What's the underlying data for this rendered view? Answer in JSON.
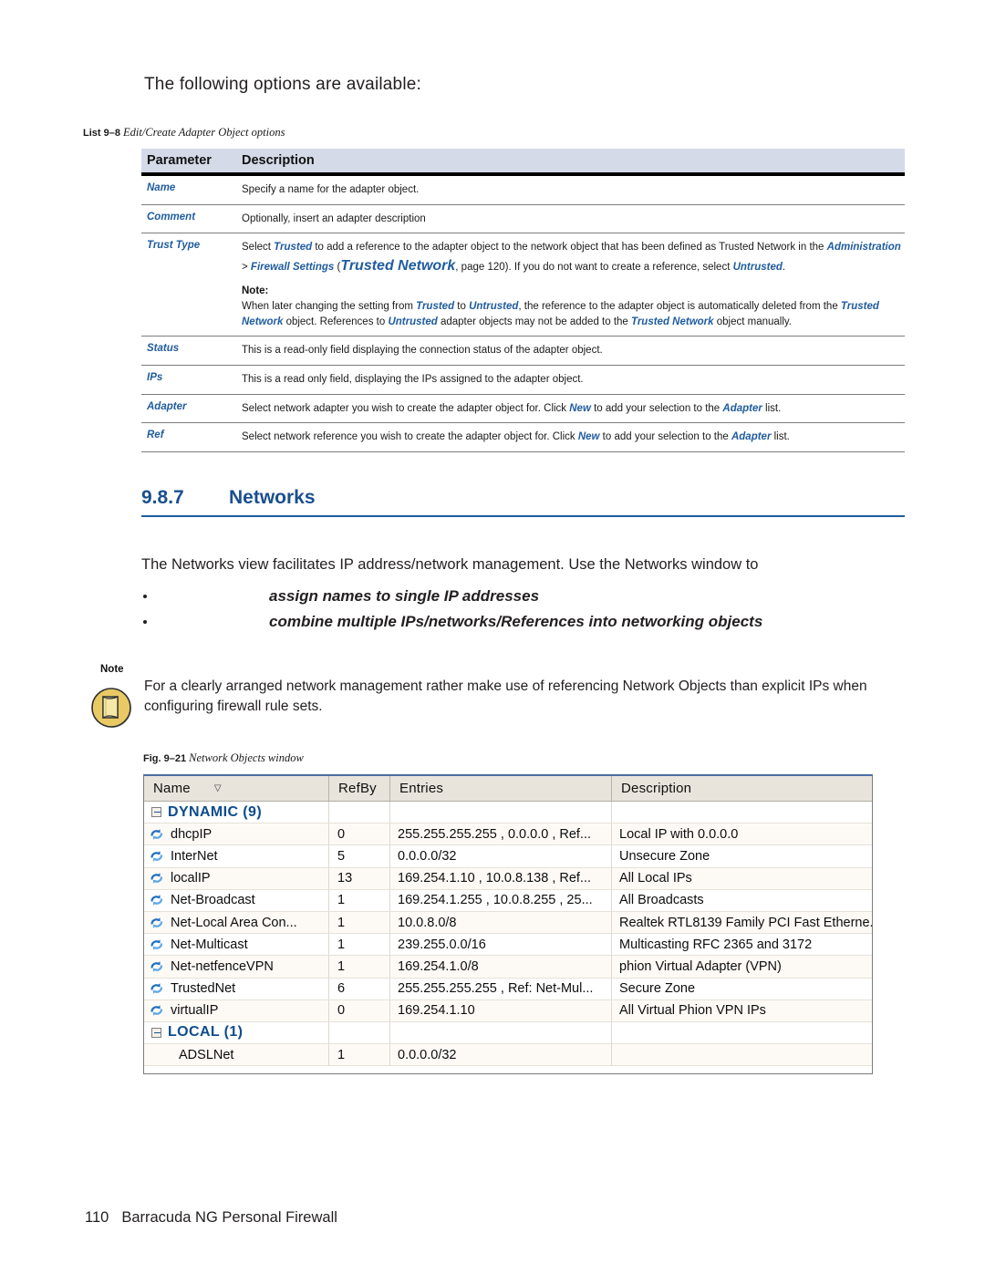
{
  "intro": "The following options are available:",
  "list_caption": {
    "lead": "List 9–8",
    "italic": "Edit/Create Adapter Object options"
  },
  "param_table": {
    "headers": {
      "parameter": "Parameter",
      "description": "Description"
    },
    "rows": [
      {
        "param": "Name",
        "desc": "Specify a name for the adapter object."
      },
      {
        "param": "Comment",
        "desc": "Optionally, insert an adapter description"
      },
      {
        "param": "Trust Type",
        "desc_segments": [
          {
            "t": "Select ",
            "s": "plain"
          },
          {
            "t": "Trusted",
            "s": "blue"
          },
          {
            "t": " to add a reference to the adapter object to the network object that has been defined as Trusted Network in the ",
            "s": "plain"
          },
          {
            "t": "Administration",
            "s": "blue"
          },
          {
            "t": " > ",
            "s": "plain"
          },
          {
            "t": "Firewall Settings",
            "s": "blue"
          },
          {
            "t": " (",
            "s": "plain"
          },
          {
            "t": "Trusted Network",
            "s": "blue-big"
          },
          {
            "t": ", page 120). If you do not want to create a reference, select ",
            "s": "plain"
          },
          {
            "t": "Untrusted",
            "s": "blue"
          },
          {
            "t": ".",
            "s": "plain"
          }
        ],
        "note_label": "Note:",
        "note_segments": [
          {
            "t": "When later changing the setting from ",
            "s": "plain"
          },
          {
            "t": "Trusted",
            "s": "blue"
          },
          {
            "t": " to ",
            "s": "plain"
          },
          {
            "t": "Untrusted",
            "s": "blue"
          },
          {
            "t": ", the reference to the adapter object is automatically deleted from the ",
            "s": "plain"
          },
          {
            "t": "Trusted Network",
            "s": "blue"
          },
          {
            "t": " object. References to ",
            "s": "plain"
          },
          {
            "t": "Untrusted",
            "s": "blue"
          },
          {
            "t": " adapter objects may not be added to the ",
            "s": "plain"
          },
          {
            "t": "Trusted Network",
            "s": "blue"
          },
          {
            "t": " object manually.",
            "s": "plain"
          }
        ]
      },
      {
        "param": "Status",
        "desc": "This is a read-only field displaying the connection status of the adapter object."
      },
      {
        "param": "IPs",
        "desc": "This is a read only field, displaying the IPs assigned to the adapter object."
      },
      {
        "param": "Adapter",
        "desc_segments": [
          {
            "t": "Select network adapter you wish to create the adapter object for. Click ",
            "s": "plain"
          },
          {
            "t": "New",
            "s": "blue"
          },
          {
            "t": " to add your selection to the ",
            "s": "plain"
          },
          {
            "t": "Adapter",
            "s": "blue"
          },
          {
            "t": " list.",
            "s": "plain"
          }
        ]
      },
      {
        "param": "Ref",
        "desc_segments": [
          {
            "t": "Select network reference you wish to create the adapter object for. Click ",
            "s": "plain"
          },
          {
            "t": "New",
            "s": "blue"
          },
          {
            "t": " to add your selection to the ",
            "s": "plain"
          },
          {
            "t": "Adapter",
            "s": "blue"
          },
          {
            "t": " list.",
            "s": "plain"
          }
        ]
      }
    ]
  },
  "section": {
    "number": "9.8.7",
    "title": "Networks"
  },
  "body_paragraph": "The Networks view facilitates IP address/network management. Use the Networks window to",
  "bullets": [
    "assign names to single IP addresses",
    "combine multiple IPs/networks/References into networking objects"
  ],
  "note": {
    "label": "Note",
    "icon": "note-document-icon",
    "text": "For a clearly arranged network management rather make use of referencing Network Objects than explicit IPs when configuring firewall rule sets."
  },
  "figure_caption": {
    "lead": "Fig. 9–21",
    "italic": "Network Objects window"
  },
  "network_objects_window": {
    "columns": [
      "Name",
      "RefBy",
      "Entries",
      "Description"
    ],
    "sort_indicator": "▽",
    "rows": [
      {
        "type": "group",
        "name": "DYNAMIC (9)",
        "refby": "",
        "entries": "",
        "description": ""
      },
      {
        "type": "item",
        "icon": "sync-arrows-icon",
        "name": "dhcpIP",
        "refby": "0",
        "entries": "255.255.255.255 , 0.0.0.0 , Ref...",
        "description": "Local IP with 0.0.0.0"
      },
      {
        "type": "item",
        "icon": "sync-arrows-icon",
        "name": "InterNet",
        "refby": "5",
        "entries": "0.0.0.0/32",
        "description": "Unsecure Zone"
      },
      {
        "type": "item",
        "icon": "sync-arrows-icon",
        "name": "localIP",
        "refby": "13",
        "entries": "169.254.1.10 , 10.0.8.138 , Ref...",
        "description": "All Local IPs"
      },
      {
        "type": "item",
        "icon": "sync-arrows-icon",
        "name": "Net-Broadcast",
        "refby": "1",
        "entries": "169.254.1.255 , 10.0.8.255 , 25...",
        "description": "All Broadcasts"
      },
      {
        "type": "item",
        "icon": "sync-arrows-icon",
        "name": "Net-Local Area Con...",
        "refby": "1",
        "entries": "10.0.8.0/8",
        "description": "Realtek RTL8139 Family PCI Fast Etherne..."
      },
      {
        "type": "item",
        "icon": "sync-arrows-icon",
        "name": "Net-Multicast",
        "refby": "1",
        "entries": "239.255.0.0/16",
        "description": "Multicasting RFC 2365 and 3172"
      },
      {
        "type": "item",
        "icon": "sync-arrows-icon",
        "name": "Net-netfenceVPN",
        "refby": "1",
        "entries": "169.254.1.0/8",
        "description": "phion Virtual Adapter (VPN)"
      },
      {
        "type": "item",
        "icon": "sync-arrows-icon",
        "name": "TrustedNet",
        "refby": "6",
        "entries": "255.255.255.255 , Ref: Net-Mul...",
        "description": "Secure Zone"
      },
      {
        "type": "item",
        "icon": "sync-arrows-icon",
        "name": "virtualIP",
        "refby": "0",
        "entries": "169.254.1.10",
        "description": "All Virtual Phion VPN IPs"
      },
      {
        "type": "group",
        "name": "LOCAL (1)",
        "refby": "",
        "entries": "",
        "description": ""
      },
      {
        "type": "plain",
        "name": "ADSLNet",
        "refby": "1",
        "entries": "0.0.0.0/32",
        "description": ""
      }
    ]
  },
  "footer": {
    "page": "110",
    "title": "Barracuda NG Personal Firewall"
  },
  "colors": {
    "accent_blue": "#1a4f8f",
    "link_blue": "#1f5c9e",
    "table_header_bg": "#d4dae8",
    "grid_header_bg": "#e8e4dc",
    "note_icon": "#e2c55e"
  }
}
